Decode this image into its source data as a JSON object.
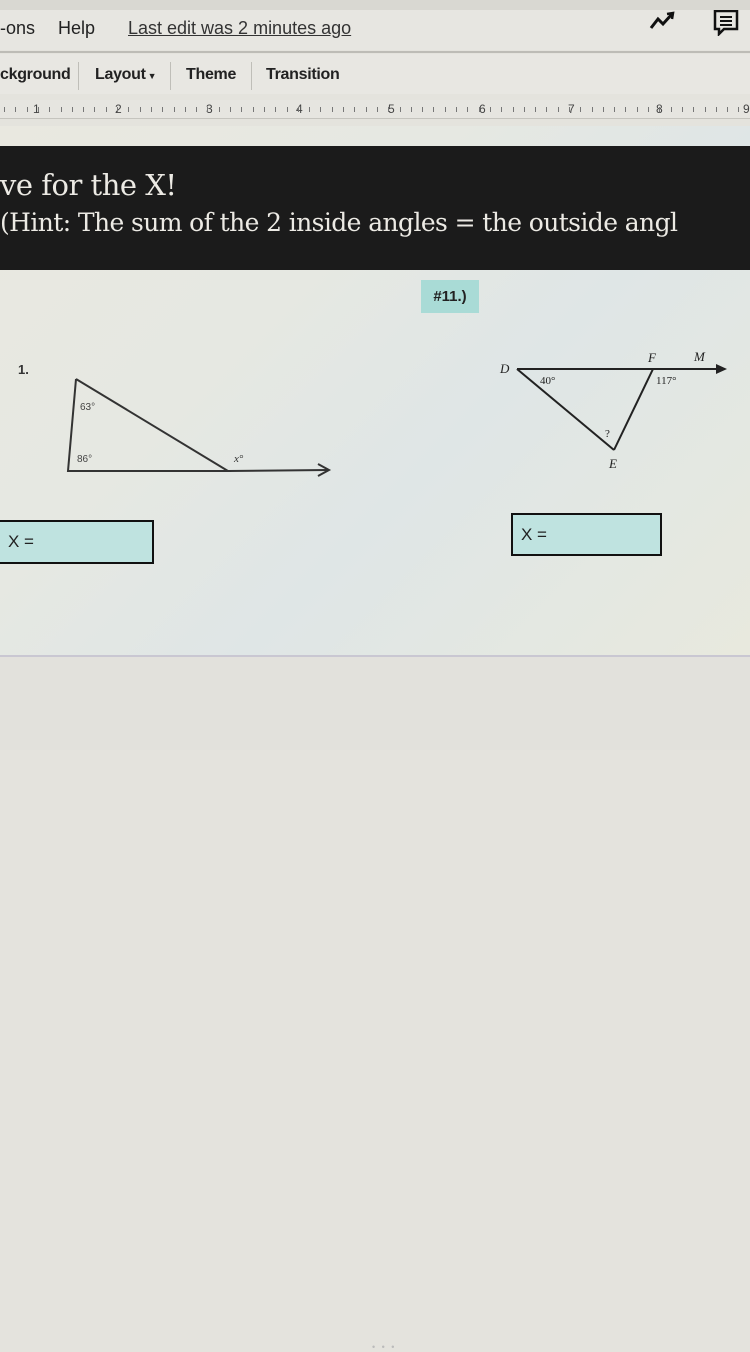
{
  "menubar": {
    "items": [
      "-ons",
      "Help"
    ],
    "last_edit": "Last edit was 2 minutes ago",
    "icons": [
      "trend-icon",
      "comment-icon"
    ]
  },
  "toolbar": {
    "items": [
      "ckground",
      "Layout",
      "Theme",
      "Transition"
    ],
    "layout_has_dropdown": true
  },
  "ruler": {
    "numbers": [
      "1",
      "2",
      "3",
      "4",
      "5",
      "6",
      "7",
      "8",
      "9"
    ]
  },
  "slide": {
    "title": "ve for the X!",
    "hint": "(Hint: The sum of the 2 inside angles = the outside angl",
    "question_label": "#11.)",
    "problem1": {
      "number": "1.",
      "angle_top": "63°",
      "angle_bottom": "86°",
      "exterior": "x°",
      "answer_label": "X ="
    },
    "problem2": {
      "vertex_d": "D",
      "vertex_f": "F",
      "vertex_m": "M",
      "vertex_e": "E",
      "angle_d": "40°",
      "exterior_f": "117°",
      "unknown": "?",
      "answer_label": "X ="
    }
  },
  "colors": {
    "banner_bg": "#1b1b1b",
    "answer_box_bg": "#bfe3e0",
    "label_bg": "#a9dbd6"
  }
}
